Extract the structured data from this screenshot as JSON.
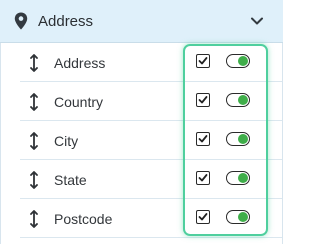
{
  "header": {
    "title": "Address",
    "icon": "map-pin-icon",
    "toggle_icon": "chevron-down-icon"
  },
  "fields": [
    {
      "label": "Address",
      "checked": true,
      "enabled": true
    },
    {
      "label": "Country",
      "checked": true,
      "enabled": true
    },
    {
      "label": "City",
      "checked": true,
      "enabled": true
    },
    {
      "label": "State",
      "checked": true,
      "enabled": true
    },
    {
      "label": "Postcode",
      "checked": true,
      "enabled": true
    }
  ],
  "colors": {
    "header_bg": "#dff0fa",
    "toggle_on": "#3fae4a",
    "highlight": "#4fcf9e"
  }
}
